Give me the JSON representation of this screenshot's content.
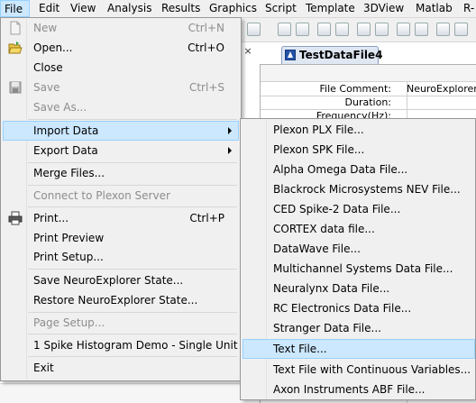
{
  "menubar": [
    {
      "name": "menu-file",
      "label": "File"
    },
    {
      "name": "menu-edit",
      "label": "Edit"
    },
    {
      "name": "menu-view",
      "label": "View"
    },
    {
      "name": "menu-analysis",
      "label": "Analysis"
    },
    {
      "name": "menu-results",
      "label": "Results"
    },
    {
      "name": "menu-graphics",
      "label": "Graphics"
    },
    {
      "name": "menu-script",
      "label": "Script"
    },
    {
      "name": "menu-template",
      "label": "Template"
    },
    {
      "name": "menu-3dview",
      "label": "3DView"
    },
    {
      "name": "menu-matlab",
      "label": "Matlab"
    },
    {
      "name": "menu-r",
      "label": "R-"
    }
  ],
  "document": {
    "tab_title": "TestDataFile4",
    "close_glyph": "×",
    "rows": [
      {
        "label": "File Comment:",
        "value": "NeuroExplorer T"
      },
      {
        "label": "Duration:",
        "value": ""
      },
      {
        "label": "Frequency(Hz):",
        "value": ""
      }
    ]
  },
  "file_menu": [
    {
      "label": "New",
      "shortcut": "Ctrl+N",
      "disabled": true,
      "icon": "new-file-icon"
    },
    {
      "label": "Open...",
      "shortcut": "Ctrl+O",
      "disabled": false,
      "icon": "open-folder-icon"
    },
    {
      "label": "Close",
      "shortcut": "",
      "disabled": false
    },
    {
      "label": "Save",
      "shortcut": "Ctrl+S",
      "disabled": true,
      "icon": "save-disk-icon"
    },
    {
      "label": "Save As...",
      "shortcut": "",
      "disabled": true
    },
    {
      "label": "Import Data",
      "shortcut": "",
      "disabled": false,
      "submenu": true,
      "highlighted": true
    },
    {
      "label": "Export Data",
      "shortcut": "",
      "disabled": false,
      "submenu": true
    },
    {
      "label": "Merge Files...",
      "shortcut": "",
      "disabled": false
    },
    {
      "label": "Connect to Plexon Server",
      "shortcut": "",
      "disabled": true
    },
    {
      "label": "Print...",
      "shortcut": "Ctrl+P",
      "disabled": false,
      "icon": "printer-icon"
    },
    {
      "label": "Print Preview",
      "shortcut": "",
      "disabled": false
    },
    {
      "label": "Print Setup...",
      "shortcut": "",
      "disabled": false
    },
    {
      "label": "Save NeuroExplorer State...",
      "shortcut": "",
      "disabled": false
    },
    {
      "label": "Restore NeuroExplorer State...",
      "shortcut": "",
      "disabled": false
    },
    {
      "label": "Page Setup...",
      "shortcut": "",
      "disabled": true
    },
    {
      "label": "1 Spike Histogram Demo - Single Unit",
      "shortcut": "",
      "disabled": false
    },
    {
      "label": "Exit",
      "shortcut": "",
      "disabled": false
    }
  ],
  "import_submenu": [
    {
      "label": "Plexon PLX File..."
    },
    {
      "label": "Plexon SPK File..."
    },
    {
      "label": "Alpha Omega Data File..."
    },
    {
      "label": "Blackrock Microsystems NEV File..."
    },
    {
      "label": "CED Spike-2 Data File..."
    },
    {
      "label": "CORTEX data file..."
    },
    {
      "label": "DataWave File..."
    },
    {
      "label": "Multichannel Systems Data File..."
    },
    {
      "label": "Neuralynx Data File..."
    },
    {
      "label": "RC Electronics Data File..."
    },
    {
      "label": "Stranger Data File..."
    },
    {
      "label": "Text File...",
      "highlighted": true
    },
    {
      "label": "Text File with Continuous Variables..."
    },
    {
      "label": "Axon Instruments ABF File..."
    }
  ],
  "colors": {
    "highlight": "#cce8ff",
    "highlight_border": "#99d1ff",
    "disabled_text": "#8d8d8d",
    "menu_bg": "#f0f0f0"
  }
}
